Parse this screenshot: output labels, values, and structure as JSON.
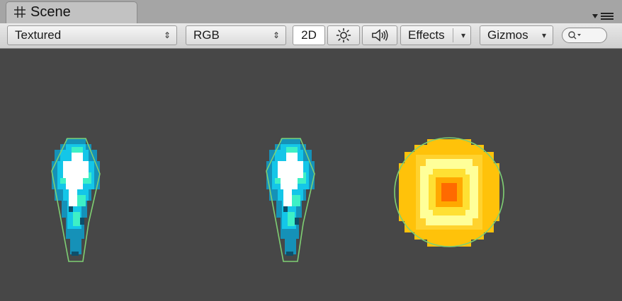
{
  "window": {
    "tab_label": "Scene",
    "tab_icon": "grid-icon",
    "panel_menu_icon": "panel-menu-icon"
  },
  "toolbar": {
    "render_mode": "Textured",
    "color_mode": "RGB",
    "mode_2d": "2D",
    "lighting_icon": "sun-icon",
    "audio_icon": "speaker-icon",
    "effects_label": "Effects",
    "gizmos_label": "Gizmos",
    "search_icon": "search-icon"
  },
  "colors": {
    "scene_bg": "#474747",
    "collider_outline": "#7fcf73",
    "crystal_dark": "#1591b8",
    "crystal_mid": "#14c6e8",
    "crystal_light": "#3ef0c6",
    "crystal_core": "#ffffff",
    "coin_outer": "#ffc20a",
    "coin_mid": "#ffe04a",
    "coin_light": "#ffff99",
    "coin_inner": "#ffa800",
    "coin_core": "#ff6a00"
  },
  "scene_objects": [
    {
      "name": "crystal-sprite-1",
      "type": "crystal"
    },
    {
      "name": "crystal-sprite-2",
      "type": "crystal"
    },
    {
      "name": "coin-sprite",
      "type": "coin"
    }
  ]
}
